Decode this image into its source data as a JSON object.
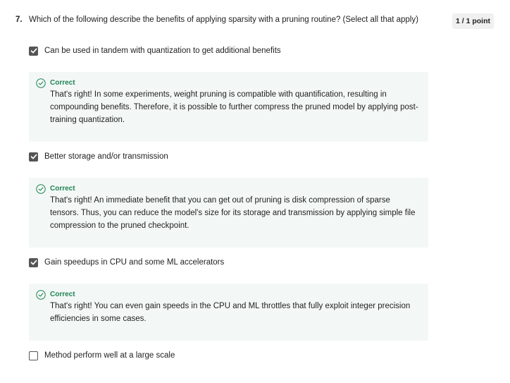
{
  "question": {
    "number": "7.",
    "text": "Which of the following describe the benefits of applying sparsity with a pruning routine? (Select all that apply)",
    "points": "1 / 1 point"
  },
  "options": [
    {
      "label": "Can be used in tandem with quantization to get additional benefits",
      "checked": true,
      "feedback": {
        "title": "Correct",
        "text": "That's right! In some experiments, weight pruning is compatible with quantification, resulting in compounding benefits. Therefore, it is possible to further compress the pruned model by applying post-training quantization."
      }
    },
    {
      "label": "Better storage and/or transmission",
      "checked": true,
      "feedback": {
        "title": "Correct",
        "text": "That's right! An immediate benefit that you can get out of pruning is disk compression of sparse tensors. Thus, you can reduce the model's size for its storage and transmission by applying simple file compression to the pruned checkpoint."
      }
    },
    {
      "label": "Gain speedups in CPU and some ML accelerators",
      "checked": true,
      "feedback": {
        "title": "Correct",
        "text": "That's right! You can even gain speeds in the CPU and ML throttles that fully exploit integer precision efficiencies in some cases."
      }
    },
    {
      "label": "Method perform well at a large scale",
      "checked": false
    }
  ],
  "colors": {
    "correct_green": "#1f8354",
    "feedback_bg": "#f3f8f6",
    "checkbox_gray": "#555555"
  },
  "icons": {
    "check": "check-icon",
    "correct": "check-circle-icon"
  }
}
